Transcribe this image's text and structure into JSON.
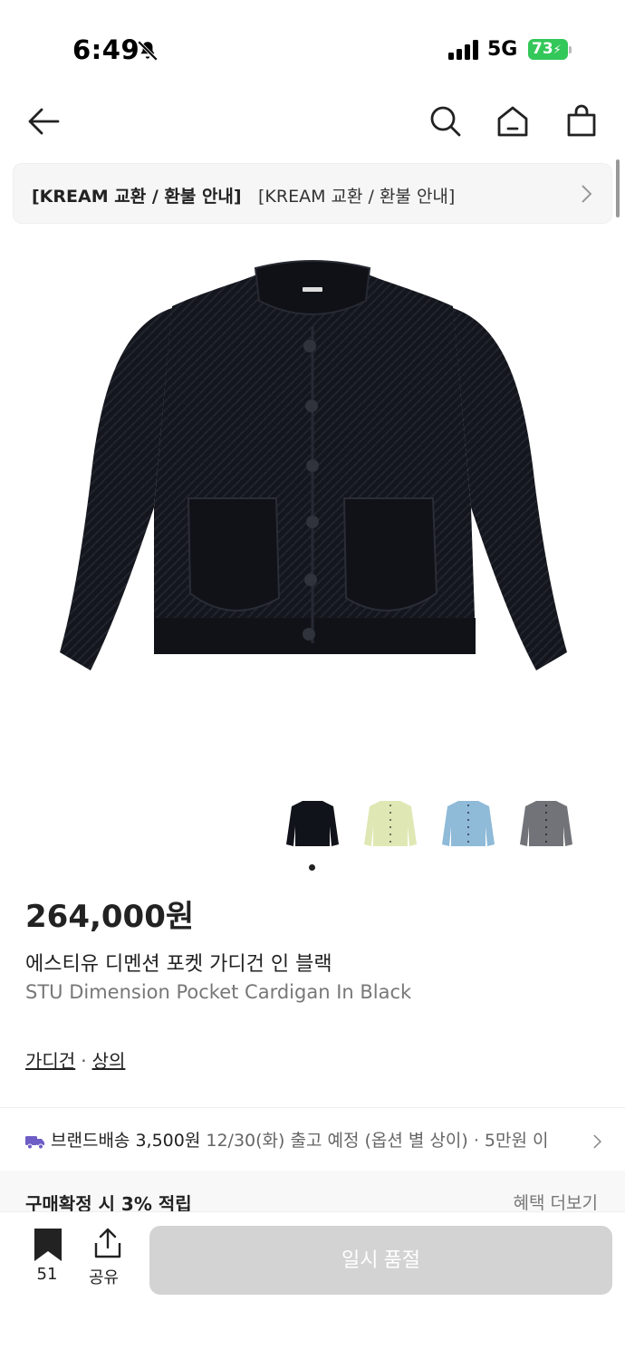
{
  "status": {
    "time": "6:49",
    "network": "5G",
    "battery": "73"
  },
  "notice": {
    "strong": "[KREAM 교환 / 환불 안내]",
    "normal": "[KREAM 교환 / 환불 안내]"
  },
  "product": {
    "price": "264,000원",
    "name_ko": "에스티유 디멘션 포켓 가디건 인 블랙",
    "name_en": "STU Dimension Pocket Cardigan In Black",
    "main_color": "#14161d",
    "variants": [
      {
        "color": "#11131a"
      },
      {
        "color": "#dfe8b4"
      },
      {
        "color": "#8fbad8"
      },
      {
        "color": "#727378"
      }
    ]
  },
  "categories": {
    "first": "가디건",
    "separator": "·",
    "second": "상의"
  },
  "delivery": {
    "type": "브랜드배송",
    "fee": "3,500원",
    "detail": "12/30(화) 출고 예정 (옵션 별 상이) · 5만원 이",
    "icon_color": "#6e5dc6"
  },
  "benefit": {
    "left": "구매확정 시 3% 적립",
    "right": "혜택 더보기"
  },
  "bottom": {
    "bookmark_count": "51",
    "share_label": "공유",
    "soldout_label": "일시 품절"
  }
}
